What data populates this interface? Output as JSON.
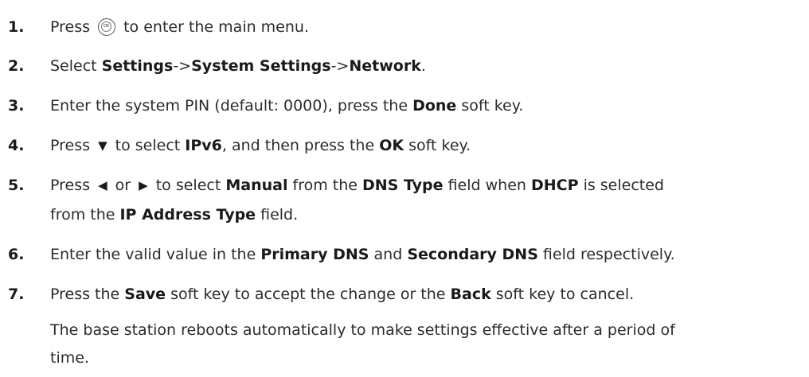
{
  "steps": [
    {
      "num": "1.",
      "t1": "Press",
      "t2": "to enter the main menu."
    },
    {
      "num": "2.",
      "t1": "Select ",
      "b1": "Settings",
      "t2": "->",
      "b2": "System Settings",
      "t3": "->",
      "b3": "Network",
      "t4": "."
    },
    {
      "num": "3.",
      "t1": "Enter the system PIN (default: 0000), press the ",
      "b1": "Done",
      "t2": " soft key."
    },
    {
      "num": "4.",
      "t1": "Press",
      "t2": "to select ",
      "b1": "IPv6",
      "t3": ", and then press the ",
      "b2": "OK",
      "t4": " soft key."
    },
    {
      "num": "5.",
      "t1": "Press",
      "t2": "or",
      "t3": "to select ",
      "b1": "Manual",
      "t4": " from the ",
      "b2": "DNS Type",
      "t5": " field when ",
      "b3": "DHCP",
      "t6": " is selected",
      "t7": "from the ",
      "b4": "IP Address Type",
      "t8": " field."
    },
    {
      "num": "6.",
      "t1": "Enter the valid value in the ",
      "b1": "Primary DNS",
      "t2": " and ",
      "b2": "Secondary DNS",
      "t3": " field respectively."
    },
    {
      "num": "7.",
      "t1": "Press the ",
      "b1": "Save",
      "t2": " soft key to accept the change or the ",
      "b2": "Back",
      "t3": " soft key to cancel."
    }
  ],
  "keys": {
    "ok_key_label": "OK",
    "down_icon": "down-arrow-key-icon",
    "left_icon": "left-arrow-key-icon",
    "right_icon": "right-arrow-key-icon"
  },
  "note": {
    "line1": "The base station reboots automatically to make settings effective after a period of",
    "line2": "time."
  }
}
